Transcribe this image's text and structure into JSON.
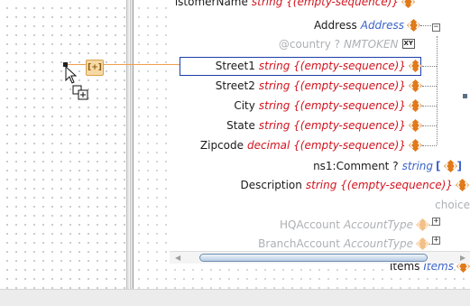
{
  "tree": {
    "rows": [
      {
        "id": "customername",
        "name": "istomerName",
        "type": "string {(empty-sequence)}",
        "dim": false,
        "partial": true
      },
      {
        "id": "address",
        "name": "Address",
        "tref": "Address",
        "dim": false
      },
      {
        "id": "country",
        "name": "@country ?",
        "tref": "NMTOKEN",
        "dim": true
      },
      {
        "id": "street1",
        "name": "Street1",
        "type": "string {(empty-sequence)}",
        "dim": false,
        "selected": true
      },
      {
        "id": "street2",
        "name": "Street2",
        "type": "string {(empty-sequence)}",
        "dim": false
      },
      {
        "id": "city",
        "name": "City",
        "type": "string {(empty-sequence)}",
        "dim": false
      },
      {
        "id": "state",
        "name": "State",
        "type": "string {(empty-sequence)}",
        "dim": false
      },
      {
        "id": "zipcode",
        "name": "Zipcode",
        "type": "decimal {(empty-sequence)}",
        "dim": false
      },
      {
        "id": "comment",
        "name": "ns1:Comment ?",
        "tref": "string",
        "dim": false
      },
      {
        "id": "description",
        "name": "Description",
        "type": "string {(empty-sequence)}",
        "dim": false
      },
      {
        "id": "choice",
        "name": "choice",
        "dim": true
      },
      {
        "id": "hqaccount",
        "name": "HQAccount",
        "tref": "AccountType",
        "dim": true
      },
      {
        "id": "branchaccount",
        "name": "BranchAccount",
        "tref": "AccountType",
        "dim": true
      },
      {
        "id": "items",
        "name": "Items",
        "tref": "Items",
        "dim": false
      }
    ],
    "attribute_badge": "XY",
    "selected_row": "Street1"
  },
  "mapping": {
    "function_icon_name": "function-node-icon",
    "cursor_icon_name": "drag-add-cursor-icon"
  },
  "colors": {
    "selection_border": "#1c3fa8",
    "mapping_line": "#f0a050",
    "element_type_red": "#d2141e",
    "type_reference_blue": "#3a63c8",
    "dim_gray": "#aeb0b4",
    "diamond_orange": "#e07a1a"
  },
  "scrollbar": {
    "left_arrow": "◀",
    "right_arrow": "▶"
  }
}
